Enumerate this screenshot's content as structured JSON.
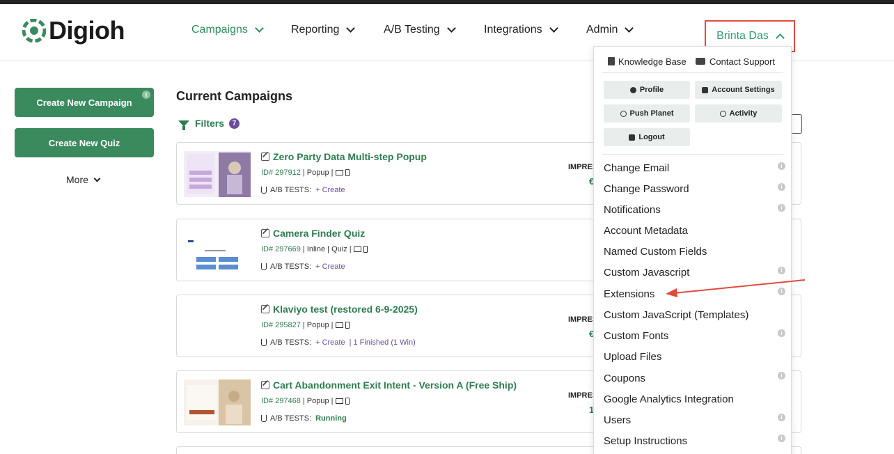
{
  "brand": {
    "name": "Digioh",
    "color": "#3b8a5e"
  },
  "nav": {
    "items": [
      {
        "label": "Campaigns"
      },
      {
        "label": "Reporting"
      },
      {
        "label": "A/B Testing"
      },
      {
        "label": "Integrations"
      },
      {
        "label": "Admin"
      }
    ],
    "user": "Brinta Das"
  },
  "sidebar": {
    "create_campaign": "Create New Campaign",
    "create_quiz": "Create New Quiz",
    "more": "More",
    "info": "i"
  },
  "main": {
    "title": "Current Campaigns",
    "filters_label": "Filters",
    "filters_count": "7",
    "impressions_label": "IMPRES",
    "campaigns": [
      {
        "title": "Zero Party Data Multi-step Popup",
        "id": "ID# 297912",
        "meta": "| Popup |",
        "ab_label": "A/B TESTS:",
        "ab_link": "+ Create",
        "ab_extra": "",
        "impr_val": "€"
      },
      {
        "title": "Camera Finder Quiz",
        "id": "ID# 297669",
        "meta": "| Inline | Quiz |",
        "ab_label": "A/B TESTS:",
        "ab_link": "+ Create",
        "ab_extra": "",
        "impr_val": ""
      },
      {
        "title": "Klaviyo test (restored 6-9-2025)",
        "id": "ID# 295827",
        "meta": "| Popup |",
        "ab_label": "A/B TESTS:",
        "ab_link": "+ Create",
        "ab_extra": "| 1 Finished (1 Win)",
        "impr_val": "€"
      },
      {
        "title": "Cart Abandonment Exit Intent - Version A (Free Ship)",
        "id": "ID# 297468",
        "meta": "| Popup |",
        "ab_label": "A/B TESTS:",
        "ab_link": "",
        "ab_extra": "Running",
        "impr_val": "1"
      }
    ]
  },
  "dropdown": {
    "knowledge_base": "Knowledge Base",
    "contact_support": "Contact Support",
    "buttons": {
      "profile": "Profile",
      "account_settings": "Account Settings",
      "push_planet": "Push Planet",
      "activity": "Activity",
      "logout": "Logout"
    },
    "items": [
      "Change Email",
      "Change Password",
      "Notifications",
      "Account Metadata",
      "Named Custom Fields",
      "Custom Javascript",
      "Extensions",
      "Custom JavaScript (Templates)",
      "Custom Fonts",
      "Upload Files",
      "Coupons",
      "Google Analytics Integration",
      "Users",
      "Setup Instructions"
    ],
    "info": "i"
  },
  "colors": {
    "accent": "#2e7d4f",
    "highlight": "#e14b3b",
    "purple": "#6b4e9b"
  }
}
